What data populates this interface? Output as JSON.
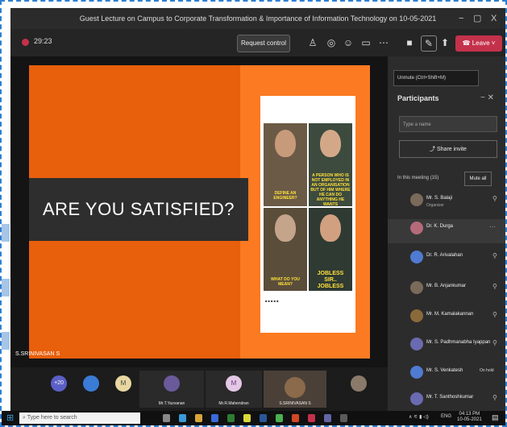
{
  "window": {
    "title": "Guest Lecture on Campus to Corporate Transformation & Importance of Information Technology on 10-05-2021",
    "minimize": "−",
    "restore": "▢",
    "close": "X"
  },
  "toolbar": {
    "timer": "29:23",
    "request_control": "Request control",
    "leave_label": "Leave"
  },
  "slide": {
    "headline": "ARE YOU SATISFIED?",
    "presenter_tag": "S.SRINIVASAN S",
    "meme_captions": [
      "DEFINE AN ENGINEER?",
      "A PERSON WHO IS NOT EMPLOYED IN AN ORGANISATION BUT OF HIM WHERE HE CAN DO ANYTHING HE WANTS",
      "WHAT DO YOU MEAN?",
      "JOBLESS SIR.. JOBLESS"
    ]
  },
  "tooltip": "Unmute (Ctrl+Shift+M)",
  "participants": {
    "title": "Participants",
    "search_placeholder": "Type a name",
    "share_invite": "Share invite",
    "in_meeting_label": "In this meeting (15)",
    "mute_all": "Mute all",
    "list": [
      {
        "name": "Mr. S. Balaji",
        "role": "Organizer",
        "color": "#7a6a5a",
        "status": ""
      },
      {
        "name": "Dr. K. Durga",
        "role": "",
        "color": "#b56a7a",
        "status": "···"
      },
      {
        "name": "Dr. R. Arivalahan",
        "role": "",
        "color": "#4f7bd1",
        "status": ""
      },
      {
        "name": "Mr. B. Anjankumar",
        "role": "",
        "color": "#7a6a5a",
        "status": ""
      },
      {
        "name": "Mr. M. Kamalakannan",
        "role": "",
        "color": "#8a6a3a",
        "status": ""
      },
      {
        "name": "Mr. S. Padhmanabha Iyappan",
        "role": "",
        "color": "#6a6ab0",
        "status": ""
      },
      {
        "name": "Mr. S. Venkatesh",
        "role": "",
        "color": "#4f7bd1",
        "status": "On hold"
      },
      {
        "name": "Mr. T. Santhoshkumar",
        "role": "",
        "color": "#6a6ab0",
        "status": ""
      }
    ]
  },
  "gallery": {
    "overflow_count": "+20",
    "tiles": [
      {
        "label": "",
        "initial": "",
        "color": "#3a7bd5"
      },
      {
        "label": "",
        "initial": "M",
        "color": "#e8d7a0"
      },
      {
        "label": "Mr.T.Yazvanan",
        "initial": "",
        "color": "#6a5a9a"
      },
      {
        "label": "Mr.R.Mahendran",
        "initial": "M",
        "color": "#e4c7e6"
      },
      {
        "label": "S.SRINIVASAN S",
        "initial": "",
        "color": "#5a4a3a"
      },
      {
        "label": "",
        "initial": "",
        "color": "#8a7a6a"
      }
    ]
  },
  "taskbar": {
    "search_placeholder": "Type here to search",
    "lang": "ENG",
    "time": "04:13 PM",
    "date": "10-05-2021"
  }
}
